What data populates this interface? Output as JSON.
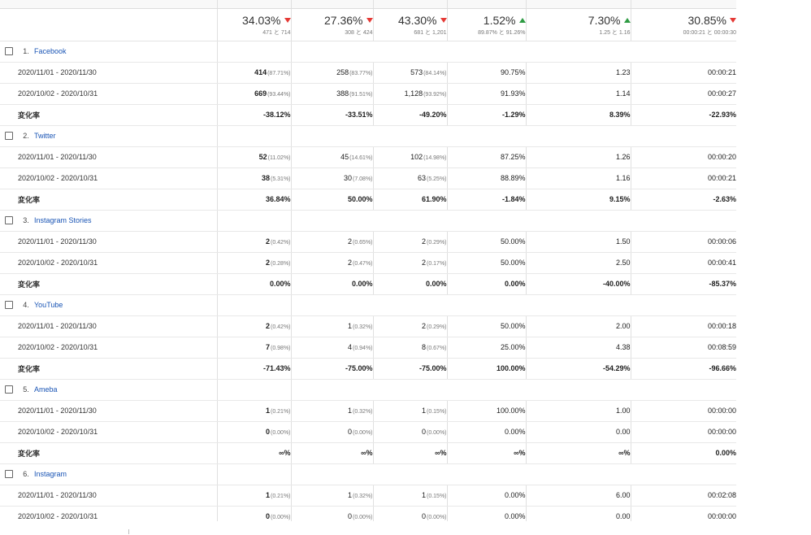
{
  "summary": [
    {
      "value": "34.03%",
      "compare": "471 と 714",
      "trend": "down"
    },
    {
      "value": "27.36%",
      "compare": "308 と 424",
      "trend": "down"
    },
    {
      "value": "43.30%",
      "compare": "681 と 1,201",
      "trend": "down"
    },
    {
      "value": "1.52%",
      "compare": "89.87% と 91.26%",
      "trend": "up"
    },
    {
      "value": "7.30%",
      "compare": "1.25 と 1.16",
      "trend": "up"
    },
    {
      "value": "30.85%",
      "compare": "00:00:21 と 00:00:30",
      "trend": "down"
    }
  ],
  "sources": [
    {
      "rank": "1.",
      "name": "Facebook",
      "rows": [
        {
          "label": "2020/11/01 - 2020/11/30",
          "cells": [
            {
              "v": "414",
              "p": "(87.71%)"
            },
            {
              "v": "258",
              "p": "(83.77%)"
            },
            {
              "v": "573",
              "p": "(84.14%)"
            },
            {
              "v": "90.75%",
              "p": ""
            },
            {
              "v": "1.23",
              "p": ""
            },
            {
              "v": "00:00:21",
              "p": ""
            }
          ]
        },
        {
          "label": "2020/10/02 - 2020/10/31",
          "cells": [
            {
              "v": "669",
              "p": "(93.44%)"
            },
            {
              "v": "388",
              "p": "(91.51%)"
            },
            {
              "v": "1,128",
              "p": "(93.92%)"
            },
            {
              "v": "91.93%",
              "p": ""
            },
            {
              "v": "1.14",
              "p": ""
            },
            {
              "v": "00:00:27",
              "p": ""
            }
          ]
        },
        {
          "label": "変化率",
          "rate": true,
          "cells": [
            {
              "v": "-38.12%",
              "p": ""
            },
            {
              "v": "-33.51%",
              "p": ""
            },
            {
              "v": "-49.20%",
              "p": ""
            },
            {
              "v": "-1.29%",
              "p": ""
            },
            {
              "v": "8.39%",
              "p": ""
            },
            {
              "v": "-22.93%",
              "p": ""
            }
          ]
        }
      ]
    },
    {
      "rank": "2.",
      "name": "Twitter",
      "rows": [
        {
          "label": "2020/11/01 - 2020/11/30",
          "cells": [
            {
              "v": "52",
              "p": "(11.02%)"
            },
            {
              "v": "45",
              "p": "(14.61%)"
            },
            {
              "v": "102",
              "p": "(14.98%)"
            },
            {
              "v": "87.25%",
              "p": ""
            },
            {
              "v": "1.26",
              "p": ""
            },
            {
              "v": "00:00:20",
              "p": ""
            }
          ]
        },
        {
          "label": "2020/10/02 - 2020/10/31",
          "cells": [
            {
              "v": "38",
              "p": "(5.31%)"
            },
            {
              "v": "30",
              "p": "(7.08%)"
            },
            {
              "v": "63",
              "p": "(5.25%)"
            },
            {
              "v": "88.89%",
              "p": ""
            },
            {
              "v": "1.16",
              "p": ""
            },
            {
              "v": "00:00:21",
              "p": ""
            }
          ]
        },
        {
          "label": "変化率",
          "rate": true,
          "cells": [
            {
              "v": "36.84%",
              "p": ""
            },
            {
              "v": "50.00%",
              "p": ""
            },
            {
              "v": "61.90%",
              "p": ""
            },
            {
              "v": "-1.84%",
              "p": ""
            },
            {
              "v": "9.15%",
              "p": ""
            },
            {
              "v": "-2.63%",
              "p": ""
            }
          ]
        }
      ]
    },
    {
      "rank": "3.",
      "name": "Instagram Stories",
      "rows": [
        {
          "label": "2020/11/01 - 2020/11/30",
          "cells": [
            {
              "v": "2",
              "p": "(0.42%)"
            },
            {
              "v": "2",
              "p": "(0.65%)"
            },
            {
              "v": "2",
              "p": "(0.29%)"
            },
            {
              "v": "50.00%",
              "p": ""
            },
            {
              "v": "1.50",
              "p": ""
            },
            {
              "v": "00:00:06",
              "p": ""
            }
          ]
        },
        {
          "label": "2020/10/02 - 2020/10/31",
          "cells": [
            {
              "v": "2",
              "p": "(0.28%)"
            },
            {
              "v": "2",
              "p": "(0.47%)"
            },
            {
              "v": "2",
              "p": "(0.17%)"
            },
            {
              "v": "50.00%",
              "p": ""
            },
            {
              "v": "2.50",
              "p": ""
            },
            {
              "v": "00:00:41",
              "p": ""
            }
          ]
        },
        {
          "label": "変化率",
          "rate": true,
          "cells": [
            {
              "v": "0.00%",
              "p": ""
            },
            {
              "v": "0.00%",
              "p": ""
            },
            {
              "v": "0.00%",
              "p": ""
            },
            {
              "v": "0.00%",
              "p": ""
            },
            {
              "v": "-40.00%",
              "p": ""
            },
            {
              "v": "-85.37%",
              "p": ""
            }
          ]
        }
      ]
    },
    {
      "rank": "4.",
      "name": "YouTube",
      "rows": [
        {
          "label": "2020/11/01 - 2020/11/30",
          "cells": [
            {
              "v": "2",
              "p": "(0.42%)"
            },
            {
              "v": "1",
              "p": "(0.32%)"
            },
            {
              "v": "2",
              "p": "(0.29%)"
            },
            {
              "v": "50.00%",
              "p": ""
            },
            {
              "v": "2.00",
              "p": ""
            },
            {
              "v": "00:00:18",
              "p": ""
            }
          ]
        },
        {
          "label": "2020/10/02 - 2020/10/31",
          "cells": [
            {
              "v": "7",
              "p": "(0.98%)"
            },
            {
              "v": "4",
              "p": "(0.94%)"
            },
            {
              "v": "8",
              "p": "(0.67%)"
            },
            {
              "v": "25.00%",
              "p": ""
            },
            {
              "v": "4.38",
              "p": ""
            },
            {
              "v": "00:08:59",
              "p": ""
            }
          ]
        },
        {
          "label": "変化率",
          "rate": true,
          "cells": [
            {
              "v": "-71.43%",
              "p": ""
            },
            {
              "v": "-75.00%",
              "p": ""
            },
            {
              "v": "-75.00%",
              "p": ""
            },
            {
              "v": "100.00%",
              "p": ""
            },
            {
              "v": "-54.29%",
              "p": ""
            },
            {
              "v": "-96.66%",
              "p": ""
            }
          ]
        }
      ]
    },
    {
      "rank": "5.",
      "name": "Ameba",
      "rows": [
        {
          "label": "2020/11/01 - 2020/11/30",
          "cells": [
            {
              "v": "1",
              "p": "(0.21%)"
            },
            {
              "v": "1",
              "p": "(0.32%)"
            },
            {
              "v": "1",
              "p": "(0.15%)"
            },
            {
              "v": "100.00%",
              "p": ""
            },
            {
              "v": "1.00",
              "p": ""
            },
            {
              "v": "00:00:00",
              "p": ""
            }
          ]
        },
        {
          "label": "2020/10/02 - 2020/10/31",
          "cells": [
            {
              "v": "0",
              "p": "(0.00%)"
            },
            {
              "v": "0",
              "p": "(0.00%)"
            },
            {
              "v": "0",
              "p": "(0.00%)"
            },
            {
              "v": "0.00%",
              "p": ""
            },
            {
              "v": "0.00",
              "p": ""
            },
            {
              "v": "00:00:00",
              "p": ""
            }
          ]
        },
        {
          "label": "変化率",
          "rate": true,
          "cells": [
            {
              "v": "∞%",
              "p": ""
            },
            {
              "v": "∞%",
              "p": ""
            },
            {
              "v": "∞%",
              "p": ""
            },
            {
              "v": "∞%",
              "p": ""
            },
            {
              "v": "∞%",
              "p": ""
            },
            {
              "v": "0.00%",
              "p": ""
            }
          ]
        }
      ]
    },
    {
      "rank": "6.",
      "name": "Instagram",
      "rows": [
        {
          "label": "2020/11/01 - 2020/11/30",
          "cells": [
            {
              "v": "1",
              "p": "(0.21%)"
            },
            {
              "v": "1",
              "p": "(0.32%)"
            },
            {
              "v": "1",
              "p": "(0.15%)"
            },
            {
              "v": "0.00%",
              "p": ""
            },
            {
              "v": "6.00",
              "p": ""
            },
            {
              "v": "00:02:08",
              "p": ""
            }
          ]
        },
        {
          "label": "2020/10/02 - 2020/10/31",
          "cells": [
            {
              "v": "0",
              "p": "(0.00%)"
            },
            {
              "v": "0",
              "p": "(0.00%)"
            },
            {
              "v": "0",
              "p": "(0.00%)"
            },
            {
              "v": "0.00%",
              "p": ""
            },
            {
              "v": "0.00",
              "p": ""
            },
            {
              "v": "00:00:00",
              "p": ""
            }
          ]
        }
      ]
    }
  ],
  "colors": {
    "link": "#1a55b5",
    "down": "#e53935",
    "up": "#2e9b43",
    "grid": "#e0e0e0"
  }
}
